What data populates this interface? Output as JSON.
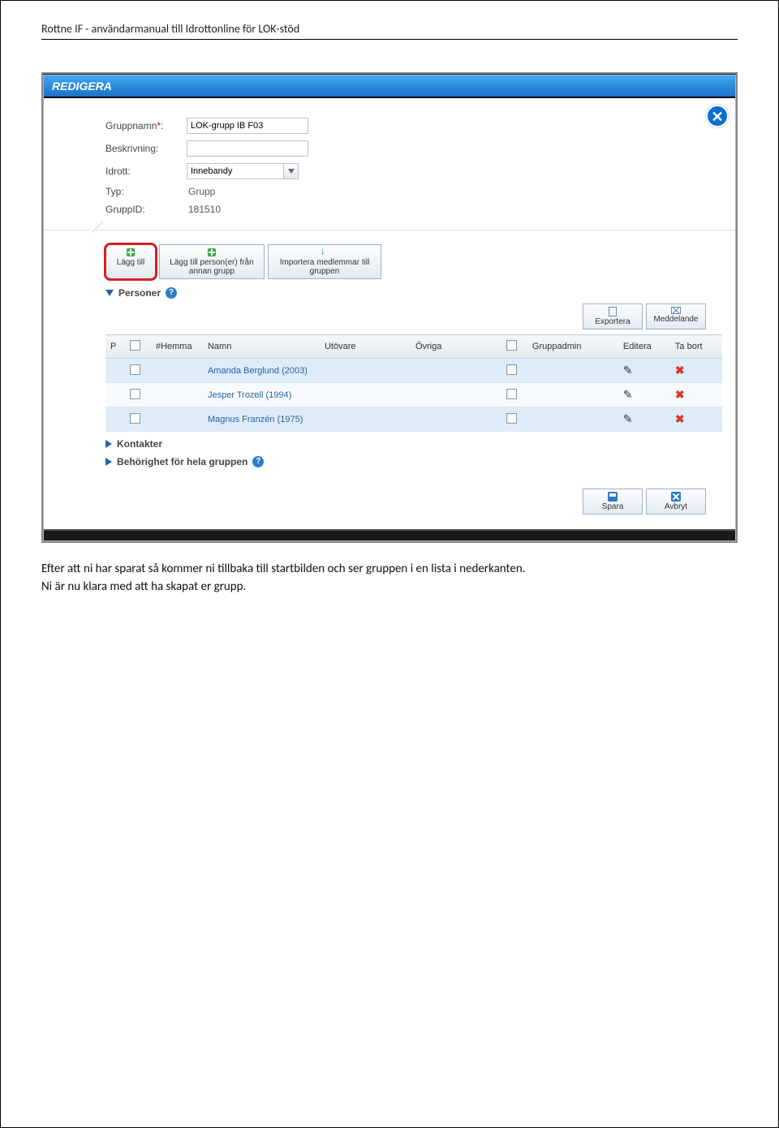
{
  "page_header": "Rottne IF -  användarmanual till Idrottonline för LOK-stöd",
  "modal": {
    "title": "REDIGERA",
    "close_aria": "Stäng",
    "form": {
      "gruppnamn_label": "Gruppnamn",
      "gruppnamn_value": "LOK-grupp IB F03",
      "beskrivning_label": "Beskrivning:",
      "beskrivning_value": "",
      "idrott_label": "Idrott:",
      "idrott_value": "Innebandy",
      "typ_label": "Typ:",
      "typ_value": "Grupp",
      "gruppid_label": "GruppID:",
      "gruppid_value": "181510"
    },
    "actions": {
      "lagg_till": "Lägg till",
      "lagg_till_annan": "Lägg till person(er) från annan grupp",
      "importera": "Importera medlemmar till gruppen",
      "exportera": "Exportera",
      "meddelande": "Meddelande",
      "spara": "Spara",
      "avbryt": "Avbryt"
    },
    "sections": {
      "personer": "Personer",
      "kontakter": "Kontakter",
      "behorighet": "Behörighet för hela gruppen"
    },
    "table": {
      "headers": {
        "p": "P",
        "hemma": "#Hemma",
        "namn": "Namn",
        "utovare": "Utövare",
        "ovriga": "Övriga",
        "gruppadmin": "Gruppadmin",
        "editera": "Editera",
        "tabort": "Ta bort"
      },
      "rows": [
        {
          "namn": "Amanda Berglund (2003)"
        },
        {
          "namn": "Jesper Trozell (1994)"
        },
        {
          "namn": "Magnus Franzén (1975)"
        }
      ]
    }
  },
  "body_text": {
    "p1": "Efter att ni har sparat så kommer ni tillbaka till startbilden och ser gruppen i en lista i nederkanten.",
    "p2": "Ni är nu klara med att ha skapat er grupp."
  }
}
